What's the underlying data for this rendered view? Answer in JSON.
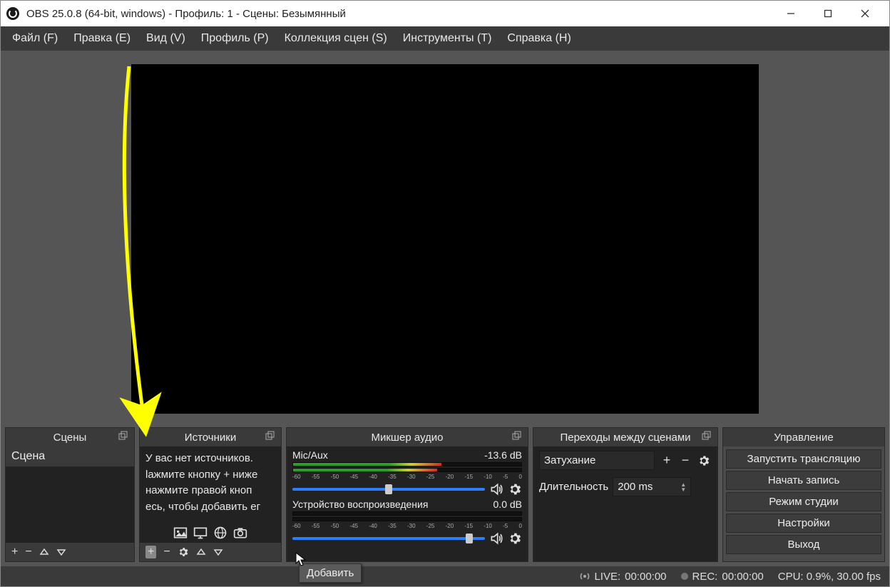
{
  "titlebar": {
    "text": "OBS 25.0.8 (64-bit, windows) - Профиль: 1 - Сцены: Безымянный"
  },
  "menu": {
    "file": "Файл (F)",
    "edit": "Правка (E)",
    "view": "Вид (V)",
    "profile": "Профиль (P)",
    "scene_collection": "Коллекция сцен (S)",
    "tools": "Инструменты (T)",
    "help": "Справка (H)"
  },
  "docks": {
    "scenes": {
      "title": "Сцены",
      "items": [
        "Сцена"
      ]
    },
    "sources": {
      "title": "Источники",
      "hint_line1": "У вас нет источников.",
      "hint_line2": "lажмите кнопку + ниже",
      "hint_line3": "нажмите правой кноп",
      "hint_line4": "есь, чтобы добавить ег"
    },
    "mixer": {
      "title": "Микшер аудио",
      "tracks": [
        {
          "name": "Mic/Aux",
          "db": "-13.6 dB",
          "fill": 65,
          "thumb": 48
        },
        {
          "name": "Устройство воспроизведения",
          "db": "0.0 dB",
          "fill": 0,
          "thumb": 90
        }
      ],
      "ticks": [
        "-60",
        "-55",
        "-50",
        "-45",
        "-40",
        "-35",
        "-30",
        "-25",
        "-20",
        "-15",
        "-10",
        "-5",
        "0"
      ]
    },
    "transitions": {
      "title": "Переходы между сценами",
      "selected": "Затухание",
      "duration_label": "Длительность",
      "duration_value": "200 ms"
    },
    "controls": {
      "title": "Управление",
      "buttons": {
        "stream": "Запустить трансляцию",
        "record": "Начать запись",
        "studio": "Режим студии",
        "settings": "Настройки",
        "exit": "Выход"
      }
    }
  },
  "status": {
    "live_label": "LIVE:",
    "live_time": "00:00:00",
    "rec_label": "REC:",
    "rec_time": "00:00:00",
    "cpu": "CPU: 0.9%, 30.00 fps"
  },
  "tooltip": "Добавить"
}
